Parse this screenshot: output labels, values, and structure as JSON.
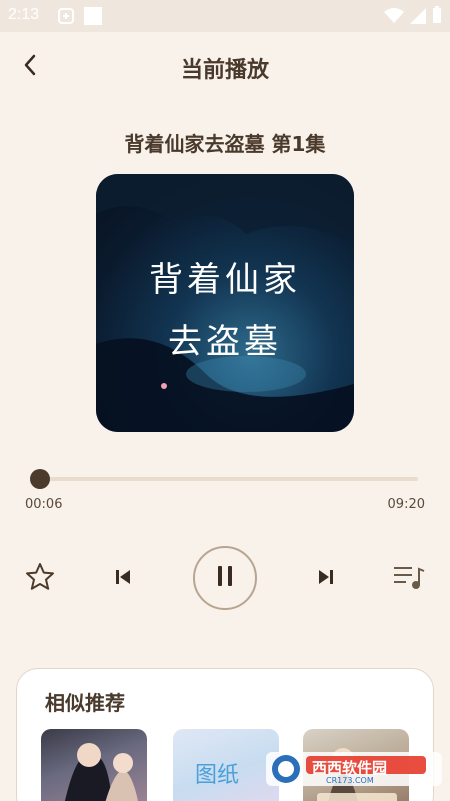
{
  "status_bar": {
    "time": "2:13"
  },
  "header": {
    "title": "当前播放"
  },
  "episode": {
    "title": "背着仙家去盗墓 第1集"
  },
  "cover": {
    "line1": "背着仙家",
    "line2": "去盗墓"
  },
  "player": {
    "current_time": "00:06",
    "total_time": "09:20",
    "progress": 0.011
  },
  "recommend": {
    "title": "相似推荐",
    "items": [
      {
        "text": ""
      },
      {
        "text": "图纸"
      },
      {
        "text": ""
      }
    ]
  },
  "watermark": {
    "text": "西西软件园",
    "sub": "CR173.COM"
  },
  "colors": {
    "background": "#f8f2ea",
    "accent": "#4c3b2c",
    "track": "#e9dccd"
  }
}
